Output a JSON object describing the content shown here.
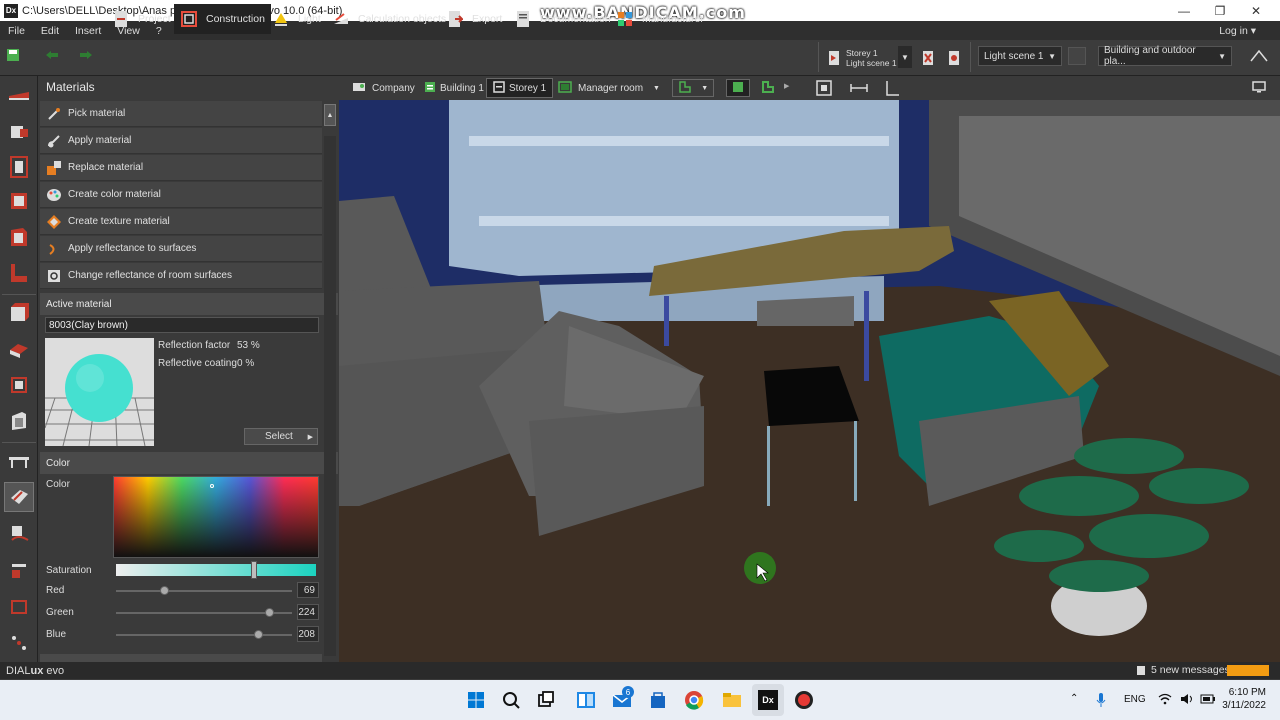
{
  "window": {
    "title": "C:\\Users\\DELL\\Desktop\\Anas proj.evo* - DIALux evo 10.0  (64-bit)",
    "app_icon": "Dx",
    "watermark": "www.BANDICAM.com"
  },
  "menubar": {
    "items": [
      "File",
      "Edit",
      "Insert",
      "View",
      "?"
    ],
    "login": "Log in"
  },
  "toolbar": {
    "tabs": [
      {
        "label": "Project",
        "icon": "project-icon"
      },
      {
        "label": "Construction",
        "icon": "construction-icon",
        "active": true
      },
      {
        "label": "Light",
        "icon": "lamp-icon"
      },
      {
        "label": "Calculation objects",
        "icon": "calc-icon"
      },
      {
        "label": "Export",
        "icon": "export-icon"
      },
      {
        "label": "Documentation",
        "icon": "document-icon"
      },
      {
        "label": "Manufacturer",
        "icon": "grid-icon"
      }
    ],
    "storey_line1": "Storey 1",
    "storey_line2": "Light scene 1",
    "light_scene": "Light scene 1",
    "view_mode": "Building and outdoor pla..."
  },
  "materials_panel": {
    "header": "Materials",
    "items": [
      "Pick material",
      "Apply material",
      "Replace material",
      "Create color material",
      "Create texture material",
      "Apply reflectance to surfaces",
      "Change reflectance of room surfaces"
    ]
  },
  "active_material": {
    "header": "Active material",
    "name": "8003(Clay brown)",
    "reflection_label": "Reflection factor",
    "reflection_value": "53 %",
    "coating_label": "Reflective coating",
    "coating_value": "0 %",
    "select_label": "Select",
    "sphere_color": "#45e0d0"
  },
  "color_section": {
    "header": "Color",
    "color_label": "Color",
    "saturation_label": "Saturation",
    "red_label": "Red",
    "red_value": "69",
    "green_label": "Green",
    "green_value": "224",
    "blue_label": "Blue",
    "blue_value": "208"
  },
  "breadcrumb": {
    "items": [
      "Company",
      "Building 1",
      "Storey 1",
      "Manager room"
    ],
    "selected": "Storey 1"
  },
  "status": {
    "brand_a": "DIAL",
    "brand_b": "ux",
    "brand_c": " evo",
    "messages": "5 new messages"
  },
  "taskbar": {
    "lang": "ENG",
    "time": "6:10 PM",
    "date": "3/11/2022",
    "mail_badge": "6"
  },
  "colors": {
    "accent_orange": "#f39c12",
    "panel_bg": "#3a3a3a",
    "wall_blue": "#1e2d66"
  }
}
